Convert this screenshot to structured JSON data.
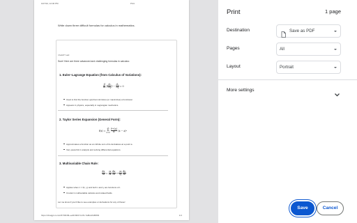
{
  "preview": {
    "header_date": "10/7/24, 12:46 PM",
    "header_title": "Print",
    "prompt": "Write down three difficult formulas for calculus in mathematics.",
    "label": "ChatGPT said:",
    "intro": "Sure! Here are three advanced and challenging formulas in calculus:",
    "sections": [
      {
        "heading": "1. Euler–Lagrange Equation (from Calculus of Variations):",
        "formula": {
          "lhs_num": "d",
          "lhs_den": "dt",
          "mid_num": "∂L",
          "mid_den": "∂q̇",
          "minus": "−",
          "rhs_num": "∂L",
          "rhs_den": "∂q",
          "eq": "= 0"
        },
        "bullets": [
          "Used to find the function q(t) that minimizes (or maximizes) a functional.",
          "Appears in physics, especially in Lagrangian mechanics."
        ]
      },
      {
        "heading": "2. Taylor Series Expansion (General Form):",
        "formula": {
          "lhs": "f(x) =",
          "sum": "∞",
          "sum_from": "n=0",
          "sum_sym": "Σ",
          "num": "f⁽ⁿ⁾(a)",
          "den": "n!",
          "tail": "(x − a)ⁿ"
        },
        "bullets": [
          "Approximates a function as an infinite sum of its derivatives at a point a.",
          "Very powerful in analysis and solving differential equations."
        ]
      },
      {
        "heading": "3. Multivariable Chain Rule:",
        "formula": {
          "lhs_num": "dz",
          "lhs_den": "dt",
          "eq": "=",
          "a_num": "∂z",
          "a_den": "∂x",
          "b_num": "dx",
          "b_den": "dt",
          "plus": "+",
          "c_num": "∂z",
          "c_den": "∂y",
          "d_num": "dy",
          "d_den": "dt"
        },
        "bullets": [
          "Applies when z = f(x, y) and both x and y are functions of t.",
          "Crucial in multivariable calculus and related fields."
        ]
      }
    ],
    "outro": "Let me know if you'd like to see examples or derivations for any of these!",
    "footer_url": "https://chatgpt.com/c/6703f4f9-ee38-8007-b2f1-7a8bdc6d5803",
    "footer_page": "1/1"
  },
  "settings": {
    "title": "Print",
    "page_count": "1 page",
    "destination": {
      "label": "Destination",
      "value": "Save as PDF",
      "icon": "pdf-file-icon"
    },
    "pages": {
      "label": "Pages",
      "value": "All"
    },
    "layout": {
      "label": "Layout",
      "value": "Portrait"
    },
    "more_settings": "More settings",
    "save_label": "Save",
    "cancel_label": "Cancel"
  },
  "colors": {
    "accent": "#0b57d0",
    "preview_bg": "#e2e2e4"
  }
}
